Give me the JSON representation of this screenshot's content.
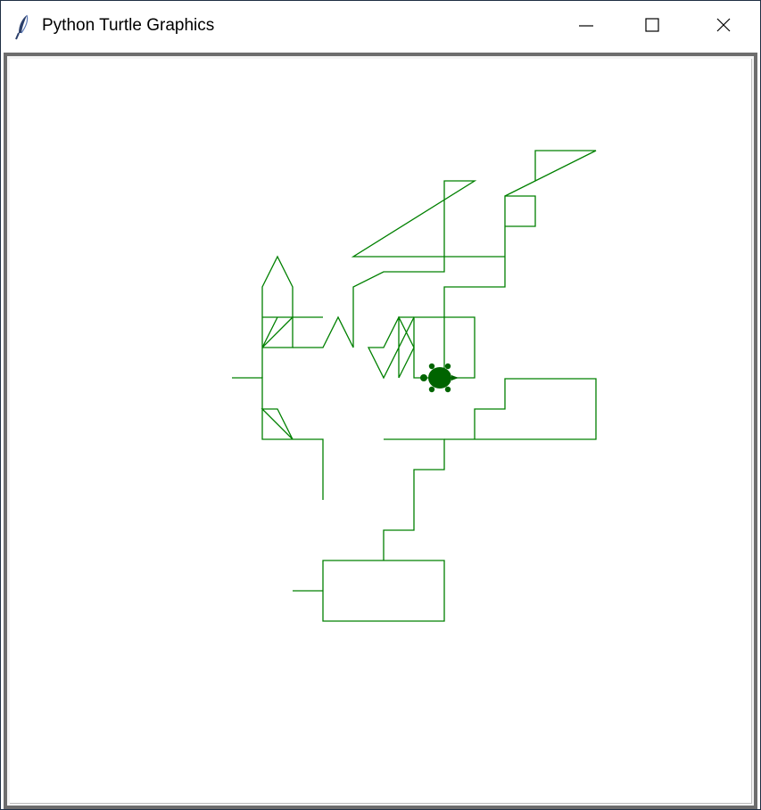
{
  "window": {
    "title": "Python Turtle Graphics",
    "app_icon": "feather-icon"
  },
  "controls": {
    "minimize_icon": "minimize-icon",
    "maximize_icon": "maximize-icon",
    "close_icon": "close-icon"
  },
  "drawing": {
    "pen_color": "#008000",
    "turtle_color": "#006400",
    "turtle_shape": "turtle"
  }
}
